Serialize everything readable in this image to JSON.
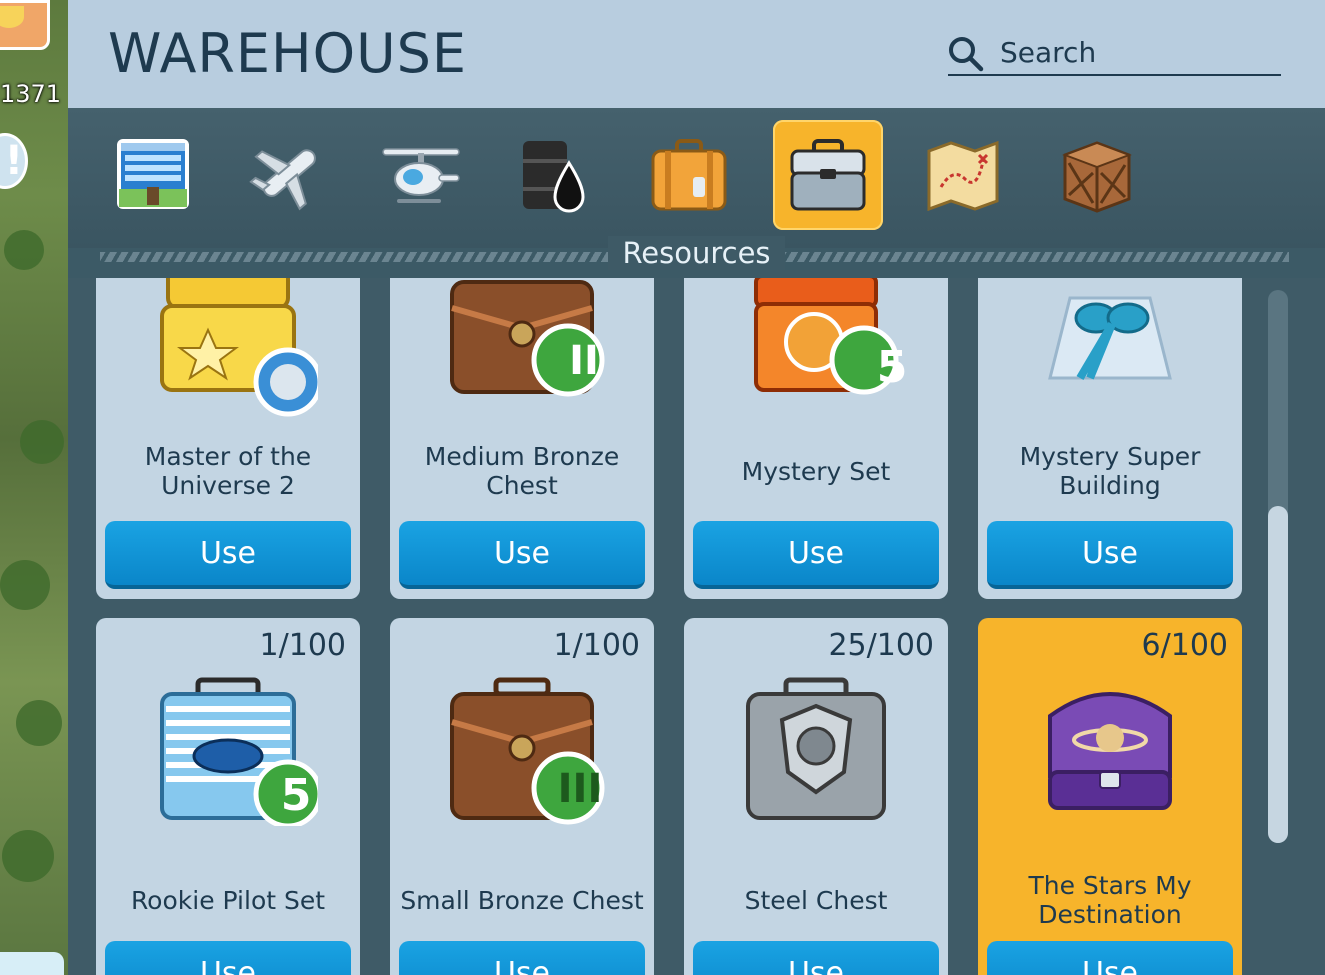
{
  "side": {
    "number": "1371"
  },
  "header": {
    "title": "WAREHOUSE"
  },
  "search": {
    "placeholder": "Search"
  },
  "tabs": [
    {
      "icon": "building-icon",
      "active": false
    },
    {
      "icon": "airplane-icon",
      "active": false
    },
    {
      "icon": "helicopter-icon",
      "active": false
    },
    {
      "icon": "oil-barrel-icon",
      "active": false
    },
    {
      "icon": "suitcase-icon",
      "active": false
    },
    {
      "icon": "toolbox-icon",
      "active": true
    },
    {
      "icon": "treasure-map-icon",
      "active": false
    },
    {
      "icon": "crate-icon",
      "active": false
    }
  ],
  "section": {
    "label": "Resources"
  },
  "items": [
    {
      "name": "Master of the Universe 2",
      "count": "",
      "button": "Use",
      "icon": "gold-chest-icon",
      "badge": ""
    },
    {
      "name": "Medium Bronze Chest",
      "count": "",
      "button": "Use",
      "icon": "bronze-chest-icon",
      "badge": "II"
    },
    {
      "name": "Mystery Set",
      "count": "",
      "button": "Use",
      "icon": "mystery-box-icon",
      "badge": "5"
    },
    {
      "name": "Mystery Super Building",
      "count": "",
      "button": "Use",
      "icon": "gift-icon",
      "badge": ""
    },
    {
      "name": "Rookie Pilot Set",
      "count": "1/100",
      "button": "Use",
      "icon": "pilot-case-icon",
      "badge": "5"
    },
    {
      "name": "Small Bronze Chest",
      "count": "1/100",
      "button": "Use",
      "icon": "bronze-chest-icon",
      "badge": "III"
    },
    {
      "name": "Steel Chest",
      "count": "25/100",
      "button": "Use",
      "icon": "steel-chest-icon",
      "badge": ""
    },
    {
      "name": "The Stars My Destination",
      "count": "6/100",
      "button": "Use",
      "icon": "purple-chest-icon",
      "badge": ""
    }
  ],
  "colors": {
    "accent": "#f7b42b",
    "button": "#0a86c9",
    "header": "#b8cddf",
    "card": "#c3d5e3"
  }
}
